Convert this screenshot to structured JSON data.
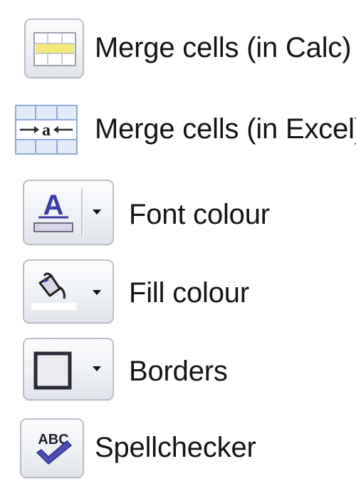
{
  "toolbar_buttons": [
    {
      "label": "Merge cells (in Calc)",
      "icon": "merge-cells-calc-icon"
    },
    {
      "label": "Merge cells (in Excel)",
      "icon": "merge-and-center-excel-icon"
    },
    {
      "label": "Font colour",
      "icon": "font-color-icon",
      "has_dropdown": true
    },
    {
      "label": "Fill colour",
      "icon": "fill-bucket-icon",
      "has_dropdown": true
    },
    {
      "label": "Borders",
      "icon": "border-box-icon",
      "has_dropdown": true
    },
    {
      "label": "Spellchecker",
      "icon": "spellcheck-abc-icon"
    }
  ],
  "icon_glyphs": {
    "font_letter": "A",
    "spell_letters": "ABC",
    "excel_letter": "a"
  },
  "colors": {
    "highlight_yellow": "#f5e87a",
    "grid_blue": "#8ea9d8",
    "font_underline": "#d7d4e8",
    "letter_blue": "#3a3aa8",
    "check_blue": "#4b4fb5"
  }
}
